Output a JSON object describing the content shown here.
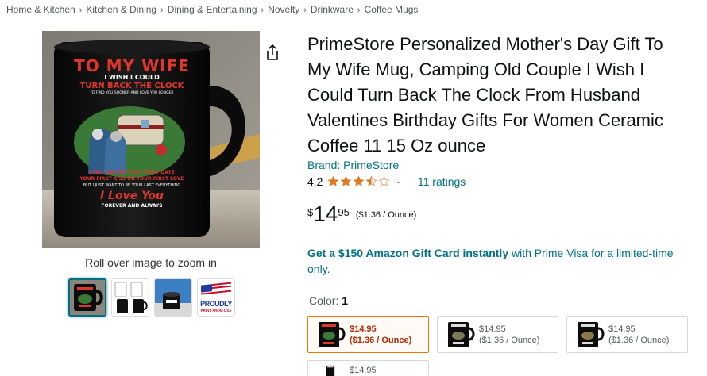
{
  "breadcrumb": [
    "Home & Kitchen",
    "Kitchen & Dining",
    "Dining & Entertaining",
    "Novelty",
    "Drinkware",
    "Coffee Mugs"
  ],
  "breadcrumb_separator": "›",
  "image": {
    "mug_text": {
      "line1": "TO MY WIFE",
      "line2": "I WISH I COULD",
      "line3": "TURN BACK THE CLOCK",
      "line4": "I'D FIND YOU SOONER AND LOVE YOU LONGER",
      "line5": "I MAY NOT BE YOUR FIRST DATE",
      "line6": "YOUR FIRST KISS OR YOUR FIRST LOVE",
      "line7": "BUT I JUST WANT TO BE YOUR LAST EVERYTHING",
      "line8": "I Love You",
      "line9": "FOREVER AND ALWAYS"
    },
    "zoom_hint": "Roll over image to zoom in",
    "thumb4_text": "PROUDLY",
    "thumb4_subtext": "PRINT FROM USA"
  },
  "product": {
    "title": "PrimeStore Personalized Mother's Day Gift To My Wife Mug, Camping Old Couple I Wish I Could Turn Back The Clock From Husband Valentines Birthday Gifts For Women Ceramic Coffee 11 15 Oz ounce",
    "brand": "Brand: PrimeStore",
    "rating": "4.2",
    "rating_value": 4.2,
    "ratings_count": "11 ratings",
    "chevron": "⌄"
  },
  "price": {
    "symbol": "$",
    "whole": "14",
    "fraction": "95",
    "per_unit": "($1.36 / Ounce)"
  },
  "promo": {
    "bold": "Get a $150 Amazon Gift Card instantly",
    "rest": " with Prime Visa for a limited-time only."
  },
  "color": {
    "label": "Color: ",
    "value": "1"
  },
  "swatches": [
    {
      "price": "$14.95",
      "unit": "($1.36 / Ounce)"
    },
    {
      "price": "$14.95",
      "unit": "($1.36 / Ounce)"
    },
    {
      "price": "$14.95",
      "unit": "($1.36 / Ounce)"
    },
    {
      "price": "$14.95",
      "unit": ""
    }
  ],
  "colors": {
    "link": "#007185",
    "star": "#de7921",
    "price_red": "#b12704",
    "selected_border": "#e77600"
  }
}
